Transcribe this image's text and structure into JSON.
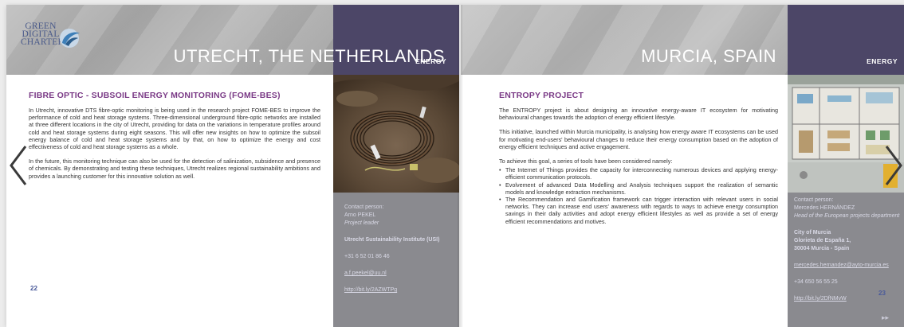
{
  "left_page": {
    "logo_line1": "GREEN",
    "logo_line2": "DIGITAL",
    "logo_line3": "CHARTER",
    "city_title": "UTRECHT, THE NETHERLANDS",
    "category": "ENERGY",
    "article_title": "FIBRE OPTIC - SUBSOIL ENERGY MONITORING (FOME-BES)",
    "paragraphs": [
      "In Utrecht, innovative DTS fibre-optic monitoring is being used in the research project FOME-BES to improve the performance of cold and heat storage systems. Three-dimensional underground fibre-optic networks are installed at three different locations in the city of Utrecht, providing for data on the variations in temperature profiles around cold and heat storage systems during eight seasons. This will offer new insights on how to optimize the subsoil energy balance of cold and heat storage systems and by that, on how to optimize the energy and cost effectiveness of cold and heat storage systems as a whole.",
      "In the future, this monitoring technique can also be used for the detection of salinization, subsidence and presence of chemicals. By demonstrating and testing these techniques, Utrecht realizes regional sustainability ambitions and provides a launching customer for this innovative solution as well."
    ],
    "contact": {
      "label": "Contact person:",
      "name": "Arno PEKEL",
      "role": "Project leader",
      "organisation": "Utrecht Sustainability Institute (USI)",
      "phone": "+31 6 52 01 86 46",
      "email": "a.f.peekel@uu.nl",
      "url": "http://bit.ly/2AZWTPg"
    },
    "page_number": "22"
  },
  "right_page": {
    "city_title": "MURCIA, SPAIN",
    "category": "ENERGY",
    "article_title": "ENTROPY PROJECT",
    "paragraphs": [
      "The ENTROPY project is about designing an innovative energy-aware IT ecosystem for motivating behavioural changes towards the adoption of energy efficient lifestyle.",
      "This initiative, launched within Murcia municipality, is analysing how energy aware IT ecosystems can be used for motivating end-users' behavioural changes to reduce their energy consumption based on the adoption of energy efficient techniques and active engagement.",
      "To achieve this goal, a series of tools have been considered namely:"
    ],
    "bullets": [
      "The Internet of Things provides the capacity for interconnecting numerous devices and applying energy-efficient communication protocols.",
      "Evolvement of advanced Data Modelling and Analysis techniques support the realization of semantic models and knowledge extraction mechanisms.",
      "The Recommendation and Gamification framework can trigger interaction with relevant users in social networks. They can increase end users' awareness with regards to ways to achieve energy consumption savings in their daily activities and adopt energy efficient lifestyles as well as provide a set of energy efficient recommendations and motives."
    ],
    "contact": {
      "label": "Contact person:",
      "name": "Mercedes HERNÁNDEZ",
      "role": "Head of the European projects department",
      "org_line1": "City of Murcia",
      "org_line2": "Glorieta de España 1,",
      "org_line3": "30004 Murcia - Spain",
      "email": "mercedes.hernandez@ayto-murcia.es",
      "phone": "+34 650 56 55 25",
      "url": "http://bit.ly/2DfNMvW"
    },
    "page_number": "23"
  },
  "navigation": {
    "prev_icon": "chevron-left-icon",
    "next_icon": "chevron-right-icon",
    "last_icon": "skip-to-end-icon",
    "last_glyph": "▸▸"
  }
}
